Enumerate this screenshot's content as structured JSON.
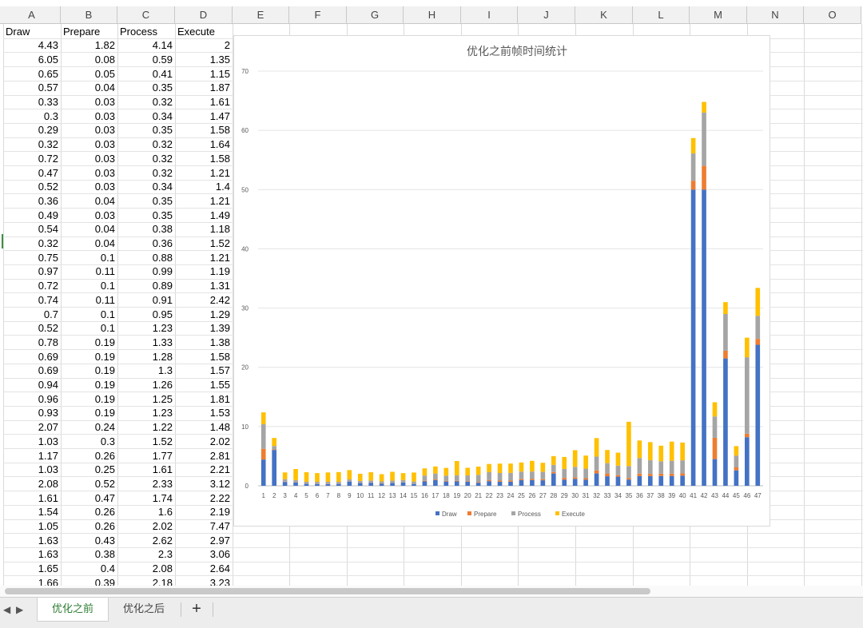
{
  "columns": [
    "A",
    "B",
    "C",
    "D",
    "E",
    "F",
    "G",
    "H",
    "I",
    "J",
    "K",
    "L",
    "M",
    "N",
    "O"
  ],
  "table": {
    "headers": [
      "Draw",
      "Prepare",
      "Process",
      "Execute"
    ],
    "rows": [
      [
        "4.43",
        "1.82",
        "4.14",
        "2"
      ],
      [
        "6.05",
        "0.08",
        "0.59",
        "1.35"
      ],
      [
        "0.65",
        "0.05",
        "0.41",
        "1.15"
      ],
      [
        "0.57",
        "0.04",
        "0.35",
        "1.87"
      ],
      [
        "0.33",
        "0.03",
        "0.32",
        "1.61"
      ],
      [
        "0.3",
        "0.03",
        "0.34",
        "1.47"
      ],
      [
        "0.29",
        "0.03",
        "0.35",
        "1.58"
      ],
      [
        "0.32",
        "0.03",
        "0.32",
        "1.64"
      ],
      [
        "0.72",
        "0.03",
        "0.32",
        "1.58"
      ],
      [
        "0.47",
        "0.03",
        "0.32",
        "1.21"
      ],
      [
        "0.52",
        "0.03",
        "0.34",
        "1.4"
      ],
      [
        "0.36",
        "0.04",
        "0.35",
        "1.21"
      ],
      [
        "0.49",
        "0.03",
        "0.35",
        "1.49"
      ],
      [
        "0.54",
        "0.04",
        "0.38",
        "1.18"
      ],
      [
        "0.32",
        "0.04",
        "0.36",
        "1.52"
      ],
      [
        "0.75",
        "0.1",
        "0.88",
        "1.21"
      ],
      [
        "0.97",
        "0.11",
        "0.99",
        "1.19"
      ],
      [
        "0.72",
        "0.1",
        "0.89",
        "1.31"
      ],
      [
        "0.74",
        "0.11",
        "0.91",
        "2.42"
      ],
      [
        "0.7",
        "0.1",
        "0.95",
        "1.29"
      ],
      [
        "0.52",
        "0.1",
        "1.23",
        "1.39"
      ],
      [
        "0.78",
        "0.19",
        "1.33",
        "1.38"
      ],
      [
        "0.69",
        "0.19",
        "1.28",
        "1.58"
      ],
      [
        "0.69",
        "0.19",
        "1.3",
        "1.57"
      ],
      [
        "0.94",
        "0.19",
        "1.26",
        "1.55"
      ],
      [
        "0.96",
        "0.19",
        "1.25",
        "1.81"
      ],
      [
        "0.93",
        "0.19",
        "1.23",
        "1.53"
      ],
      [
        "2.07",
        "0.24",
        "1.22",
        "1.48"
      ],
      [
        "1.03",
        "0.3",
        "1.52",
        "2.02"
      ],
      [
        "1.17",
        "0.26",
        "1.77",
        "2.81"
      ],
      [
        "1.03",
        "0.25",
        "1.61",
        "2.21"
      ],
      [
        "2.08",
        "0.52",
        "2.33",
        "3.12"
      ],
      [
        "1.61",
        "0.47",
        "1.74",
        "2.22"
      ],
      [
        "1.54",
        "0.26",
        "1.6",
        "2.19"
      ],
      [
        "1.05",
        "0.26",
        "2.02",
        "7.47"
      ],
      [
        "1.63",
        "0.43",
        "2.62",
        "2.97"
      ],
      [
        "1.63",
        "0.38",
        "2.3",
        "3.06"
      ],
      [
        "1.65",
        "0.4",
        "2.08",
        "2.64"
      ],
      [
        "1.66",
        "0.39",
        "2.18",
        "3.23"
      ]
    ]
  },
  "chart_data": {
    "type": "bar",
    "stacked": true,
    "title": "优化之前帧时间统计",
    "xlabel": "",
    "ylabel": "",
    "ylim": [
      0,
      70
    ],
    "yticks": [
      0,
      10,
      20,
      30,
      40,
      50,
      60,
      70
    ],
    "grid": true,
    "legend": "bottom",
    "categories": [
      "1",
      "2",
      "3",
      "4",
      "5",
      "6",
      "7",
      "8",
      "9",
      "10",
      "11",
      "12",
      "13",
      "14",
      "15",
      "16",
      "17",
      "18",
      "19",
      "20",
      "21",
      "22",
      "23",
      "24",
      "25",
      "26",
      "27",
      "28",
      "29",
      "30",
      "31",
      "32",
      "33",
      "34",
      "35",
      "36",
      "37",
      "38",
      "39",
      "40",
      "41",
      "42",
      "43",
      "44",
      "45",
      "46",
      "47"
    ],
    "series": [
      {
        "name": "Draw",
        "color": "#4472c4",
        "values": [
          4.43,
          6.05,
          0.65,
          0.57,
          0.33,
          0.3,
          0.29,
          0.32,
          0.72,
          0.47,
          0.52,
          0.36,
          0.49,
          0.54,
          0.32,
          0.75,
          0.97,
          0.72,
          0.74,
          0.7,
          0.52,
          0.78,
          0.69,
          0.69,
          0.94,
          0.96,
          0.93,
          2.07,
          1.03,
          1.17,
          1.03,
          2.08,
          1.61,
          1.54,
          1.05,
          1.63,
          1.63,
          1.65,
          1.66,
          1.7,
          50,
          50,
          4.5,
          21.5,
          2.6,
          8.2,
          23.8
        ]
      },
      {
        "name": "Prepare",
        "color": "#ed7d31",
        "values": [
          1.82,
          0.08,
          0.05,
          0.04,
          0.03,
          0.03,
          0.03,
          0.03,
          0.03,
          0.03,
          0.03,
          0.04,
          0.03,
          0.04,
          0.04,
          0.1,
          0.11,
          0.1,
          0.11,
          0.1,
          0.1,
          0.19,
          0.19,
          0.19,
          0.19,
          0.19,
          0.19,
          0.24,
          0.3,
          0.26,
          0.25,
          0.52,
          0.47,
          0.26,
          0.26,
          0.43,
          0.38,
          0.4,
          0.39,
          0.4,
          1.5,
          4,
          3.6,
          1.3,
          0.5,
          0.6,
          1
        ]
      },
      {
        "name": "Process",
        "color": "#a5a5a5",
        "values": [
          4.14,
          0.59,
          0.41,
          0.35,
          0.32,
          0.34,
          0.35,
          0.32,
          0.32,
          0.32,
          0.34,
          0.35,
          0.35,
          0.38,
          0.36,
          0.88,
          0.99,
          0.89,
          0.91,
          0.95,
          1.23,
          1.33,
          1.28,
          1.3,
          1.26,
          1.25,
          1.23,
          1.22,
          1.52,
          1.77,
          1.61,
          2.33,
          1.74,
          1.6,
          2.02,
          2.62,
          2.3,
          2.08,
          2.18,
          2.2,
          4.6,
          9,
          3.6,
          6.2,
          2,
          12.9,
          3.9
        ]
      },
      {
        "name": "Execute",
        "color": "#ffc000",
        "values": [
          2,
          1.35,
          1.15,
          1.87,
          1.61,
          1.47,
          1.58,
          1.64,
          1.58,
          1.21,
          1.4,
          1.21,
          1.49,
          1.18,
          1.52,
          1.21,
          1.19,
          1.31,
          2.42,
          1.29,
          1.39,
          1.38,
          1.58,
          1.57,
          1.55,
          1.81,
          1.53,
          1.48,
          2.02,
          2.81,
          2.21,
          3.12,
          2.22,
          2.19,
          7.47,
          2.97,
          3.06,
          2.64,
          3.23,
          3,
          2.6,
          1.8,
          2.4,
          2,
          1.6,
          3.3,
          4.7
        ]
      }
    ]
  },
  "sheets": {
    "tabs": [
      "优化之前",
      "优化之后"
    ],
    "active": 0,
    "add_label": "+",
    "prev_label": "◀",
    "next_label": "▶"
  }
}
